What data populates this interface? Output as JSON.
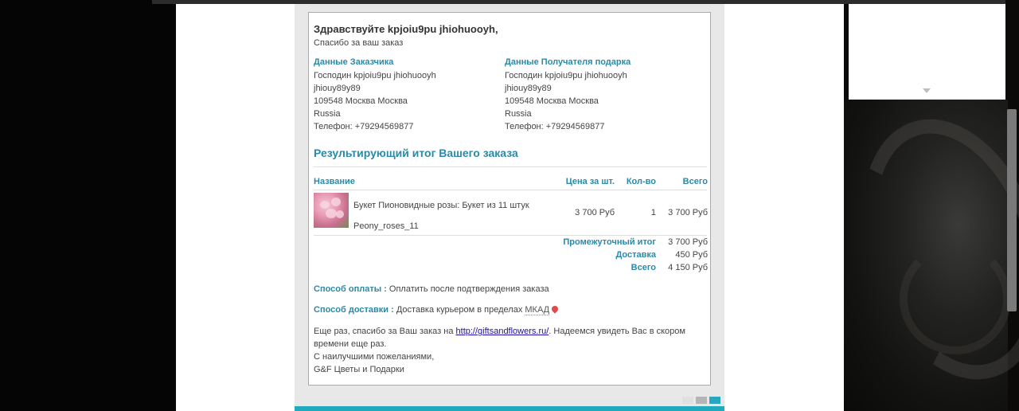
{
  "greeting": "Здравствуйте kpjoiu9pu jhiohuooyh,",
  "thanks_line": "Спасибо за ваш заказ",
  "customer": {
    "heading": "Данные Заказчика",
    "lines": [
      "Господин kpjoiu9pu jhiohuooyh",
      "jhiouy89y89",
      "109548 Москва Москва",
      "Russia",
      "Телефон: +79294569877"
    ]
  },
  "recipient": {
    "heading": "Данные Получателя подарка",
    "lines": [
      "Господин kpjoiu9pu jhiohuooyh",
      "jhiouy89y89",
      "109548 Москва Москва",
      "Russia",
      "Телефон: +79294569877"
    ]
  },
  "summary_title": "Результирующий итог Вашего заказа",
  "table": {
    "headers": {
      "name": "Название",
      "price": "Цена за шт.",
      "qty": "Кол-во",
      "total": "Всего"
    },
    "item": {
      "name": "Букет Пионовидные розы: Букет из 11 штук",
      "sku": "Peony_roses_11",
      "price": "3 700 Руб",
      "qty": "1",
      "total": "3 700 Руб"
    }
  },
  "totals": {
    "subtotal_label": "Промежуточный итог",
    "subtotal": "3 700 Руб",
    "delivery_label": "Доставка",
    "delivery": "450 Руб",
    "total_label": "Всего",
    "total": "4 150 Руб"
  },
  "payment": {
    "label": "Способ оплаты :",
    "value": "Оплатить после подтверждения заказа"
  },
  "shipping": {
    "label": "Способ доставки :",
    "value": "Доставка курьером в пределах ",
    "area": "МКАД"
  },
  "closing": {
    "p1_start": "Еще раз, спасибо за Ваш заказ на ",
    "link": "http://giftsandflowers.ru/",
    "p1_end": ". Надеемся увидеть Вас в скором",
    "p2": "времени еще раз.",
    "p3": "С наилучшими пожеланиями,",
    "p4": "G&F Цветы и Подарки"
  },
  "colors": {
    "accent": "#2a8aa8",
    "teal_bar": "#1faabd",
    "dots": [
      "#e0e0e0",
      "#b5b5b5",
      "#2aa7c0"
    ]
  },
  "icons": {
    "location": "map-pin-icon",
    "dropdown": "caret-down-icon"
  }
}
